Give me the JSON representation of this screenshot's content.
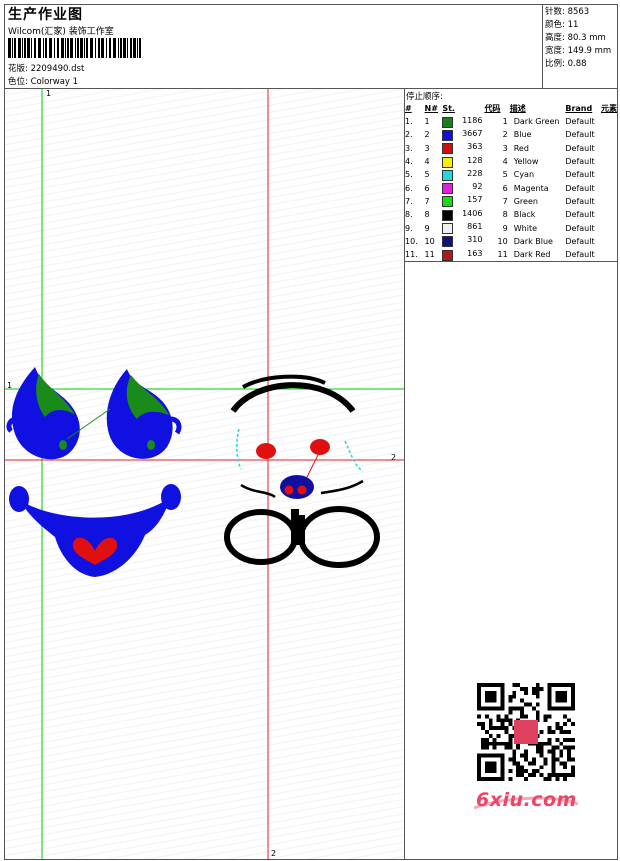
{
  "header": {
    "title": "生产作业图",
    "company": "Wilcom(汇家) 装饰工作室",
    "design_label": "花版:",
    "design_value": "2209490.dst",
    "colorway_label": "色位:",
    "colorway_value": "Colorway 1"
  },
  "stats": [
    {
      "label": "针数:",
      "value": "8563"
    },
    {
      "label": "颜色:",
      "value": "11"
    },
    {
      "label": "高度:",
      "value": "80.3 mm"
    },
    {
      "label": "宽度:",
      "value": "149.9 mm"
    },
    {
      "label": "比例:",
      "value": "0.88"
    }
  ],
  "stop_sequence": {
    "title": "停止顺序:",
    "headers": [
      "#",
      "N#",
      "St.",
      "代码",
      "描述",
      "Brand",
      "元素"
    ],
    "rows": [
      {
        "n": "1.",
        "nn": "1",
        "color": "#1a7f1a",
        "st": "1186",
        "code": "1",
        "desc": "Dark Green",
        "brand": "Default"
      },
      {
        "n": "2.",
        "nn": "2",
        "color": "#1010d8",
        "st": "3667",
        "code": "2",
        "desc": "Blue",
        "brand": "Default"
      },
      {
        "n": "3.",
        "nn": "3",
        "color": "#d01010",
        "st": "363",
        "code": "3",
        "desc": "Red",
        "brand": "Default"
      },
      {
        "n": "4.",
        "nn": "4",
        "color": "#f4f000",
        "st": "128",
        "code": "4",
        "desc": "Yellow",
        "brand": "Default"
      },
      {
        "n": "5.",
        "nn": "5",
        "color": "#20d8e0",
        "st": "228",
        "code": "5",
        "desc": "Cyan",
        "brand": "Default"
      },
      {
        "n": "6.",
        "nn": "6",
        "color": "#e020e0",
        "st": "92",
        "code": "6",
        "desc": "Magenta",
        "brand": "Default"
      },
      {
        "n": "7.",
        "nn": "7",
        "color": "#10e010",
        "st": "157",
        "code": "7",
        "desc": "Green",
        "brand": "Default"
      },
      {
        "n": "8.",
        "nn": "8",
        "color": "#000000",
        "st": "1406",
        "code": "8",
        "desc": "Black",
        "brand": "Default"
      },
      {
        "n": "9.",
        "nn": "9",
        "color": "#f0f0f0",
        "st": "861",
        "code": "9",
        "desc": "White",
        "brand": "Default"
      },
      {
        "n": "10.",
        "nn": "10",
        "color": "#101080",
        "st": "310",
        "code": "10",
        "desc": "Dark Blue",
        "brand": "Default"
      },
      {
        "n": "11.",
        "nn": "11",
        "color": "#b01818",
        "st": "163",
        "code": "11",
        "desc": "Dark Red",
        "brand": "Default"
      }
    ]
  },
  "axes": {
    "v1": "1",
    "h1": "1",
    "h2": "2",
    "v2": "2"
  },
  "watermark": {
    "text": "6xiu.com"
  }
}
